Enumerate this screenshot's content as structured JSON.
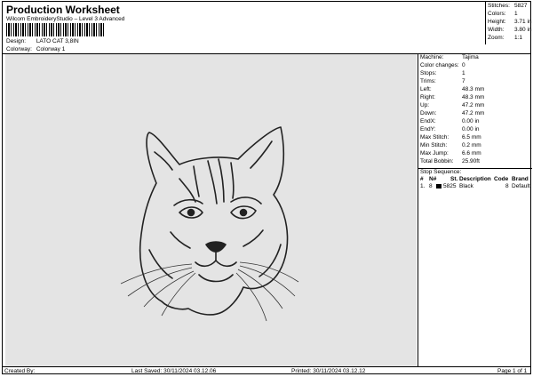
{
  "header": {
    "title": "Production Worksheet",
    "subtitle": "Wilcom EmbroideryStudio – Level 3 Advanced",
    "design_label": "Design:",
    "design_value": "LATO CAT 3,8IN",
    "colorway_label": "Colorway:",
    "colorway_value": "Colorway 1"
  },
  "stats": [
    {
      "label": "Stitches:",
      "value": "5827"
    },
    {
      "label": "Colors:",
      "value": "1"
    },
    {
      "label": "Height:",
      "value": "3.71 in"
    },
    {
      "label": "Width:",
      "value": "3.80 in"
    },
    {
      "label": "Zoom:",
      "value": "1:1"
    }
  ],
  "machine_info": [
    {
      "label": "Machine:",
      "value": "Tajima"
    },
    {
      "label": "Color changes:",
      "value": "0"
    },
    {
      "label": "Stops:",
      "value": "1"
    },
    {
      "label": "Trims:",
      "value": "7"
    },
    {
      "label": "Left:",
      "value": "48.3 mm"
    },
    {
      "label": "Right:",
      "value": "48.3 mm"
    },
    {
      "label": "Up:",
      "value": "47.2 mm"
    },
    {
      "label": "Down:",
      "value": "47.2 mm"
    },
    {
      "label": "EndX:",
      "value": "0.00 in"
    },
    {
      "label": "EndY:",
      "value": "0.00 in"
    },
    {
      "label": "Max Stitch:",
      "value": "6.5 mm"
    },
    {
      "label": "Min Stitch:",
      "value": "0.2 mm"
    },
    {
      "label": "Max Jump:",
      "value": "6.6 mm"
    },
    {
      "label": "Total Bobbin:",
      "value": "25.90ft"
    }
  ],
  "stop_sequence": {
    "title": "Stop Sequence:",
    "columns": [
      "#",
      "N#",
      "St.",
      "Description",
      "Code",
      "Brand"
    ],
    "rows": [
      {
        "index": "1.",
        "needle": "8",
        "stitches": "5825",
        "description": "Black",
        "code": "8",
        "brand": "Default",
        "color": "#000000"
      }
    ]
  },
  "footer": {
    "created_by": "Created By:",
    "last_saved": "Last Saved: 30/11/2024 03.12.06",
    "printed": "Printed: 30/11/2024 03.12.12",
    "page": "Page 1 of 1"
  },
  "barcode_text": "*"
}
